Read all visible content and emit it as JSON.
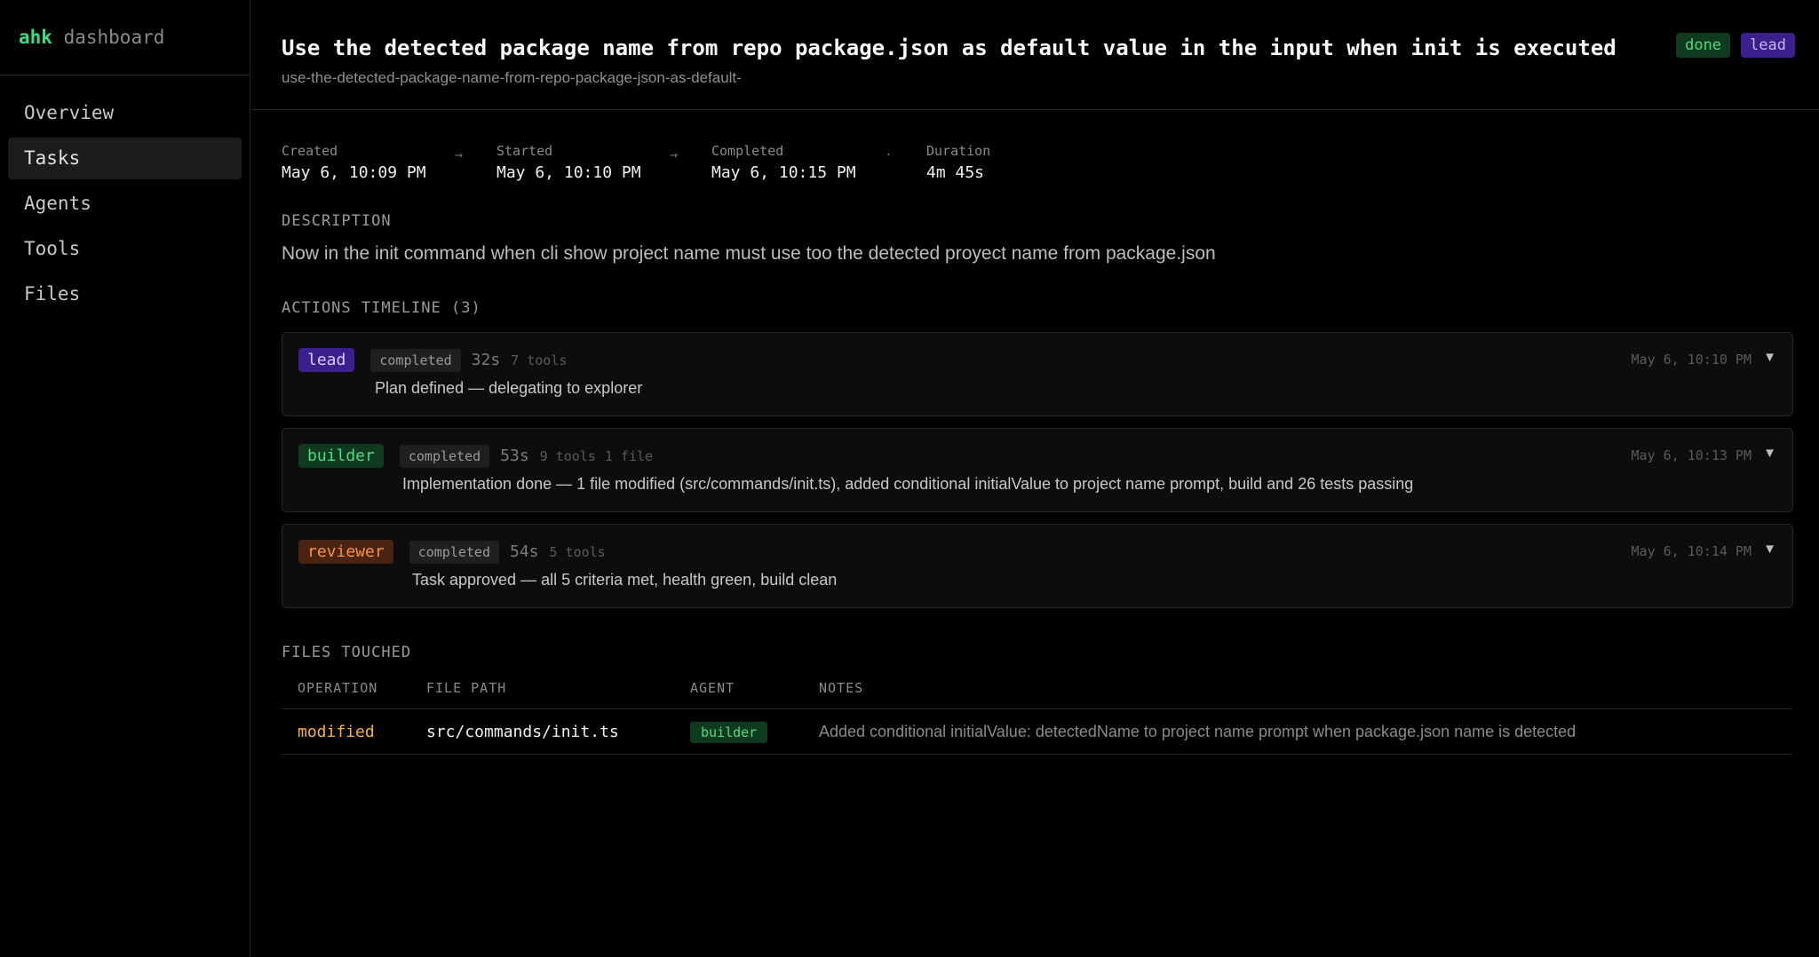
{
  "brand": {
    "name_bold": "ahk",
    "name_rest": "dashboard"
  },
  "nav": {
    "items": [
      {
        "label": "Overview",
        "active": false
      },
      {
        "label": "Tasks",
        "active": true
      },
      {
        "label": "Agents",
        "active": false
      },
      {
        "label": "Tools",
        "active": false
      },
      {
        "label": "Files",
        "active": false
      }
    ]
  },
  "task": {
    "title": "Use the detected package name from repo package.json as default value in the input when init is executed",
    "slug": "use-the-detected-package-name-from-repo-package-json-as-default-",
    "badges": {
      "status": "done",
      "agent": "lead"
    }
  },
  "meta": [
    {
      "label": "Created",
      "value": "May 6, 10:09 PM",
      "sep": "→"
    },
    {
      "label": "Started",
      "value": "May 6, 10:10 PM",
      "sep": "→"
    },
    {
      "label": "Completed",
      "value": "May 6, 10:15 PM",
      "sep": "·"
    },
    {
      "label": "Duration",
      "value": "4m 45s",
      "sep": ""
    }
  ],
  "description": {
    "label": "DESCRIPTION",
    "text": "Now in the init command when cli show project name must use too the detected proyect name from package.json"
  },
  "timeline": {
    "label": "ACTIONS TIMELINE (3)",
    "actions": [
      {
        "agent": "lead",
        "status": "completed",
        "duration": "32s",
        "tools": "7 tools",
        "files": "",
        "summary": "Plan defined — delegating to explorer",
        "time": "May 6, 10:10 PM",
        "chevron": "▼"
      },
      {
        "agent": "builder",
        "status": "completed",
        "duration": "53s",
        "tools": "9 tools",
        "files": "1 file",
        "summary": "Implementation done — 1 file modified (src/commands/init.ts), added conditional initialValue to project name prompt, build and 26 tests passing",
        "time": "May 6, 10:13 PM",
        "chevron": "▼"
      },
      {
        "agent": "reviewer",
        "status": "completed",
        "duration": "54s",
        "tools": "5 tools",
        "files": "",
        "summary": "Task approved — all 5 criteria met, health green, build clean",
        "time": "May 6, 10:14 PM",
        "chevron": "▼"
      }
    ]
  },
  "files": {
    "label": "FILES TOUCHED",
    "columns": [
      "OPERATION",
      "FILE PATH",
      "AGENT",
      "NOTES"
    ],
    "rows": [
      {
        "operation": "modified",
        "path": "src/commands/init.ts",
        "agent": "builder",
        "notes": "Added conditional initialValue: detectedName to project name prompt when package.json name is detected"
      }
    ]
  },
  "colors": {
    "background": "#000000",
    "accent_green": "#4ade80",
    "lead_purple": "#3b1f8c",
    "reviewer_orange": "#fb923c",
    "modified_yellow": "#f5b342"
  }
}
